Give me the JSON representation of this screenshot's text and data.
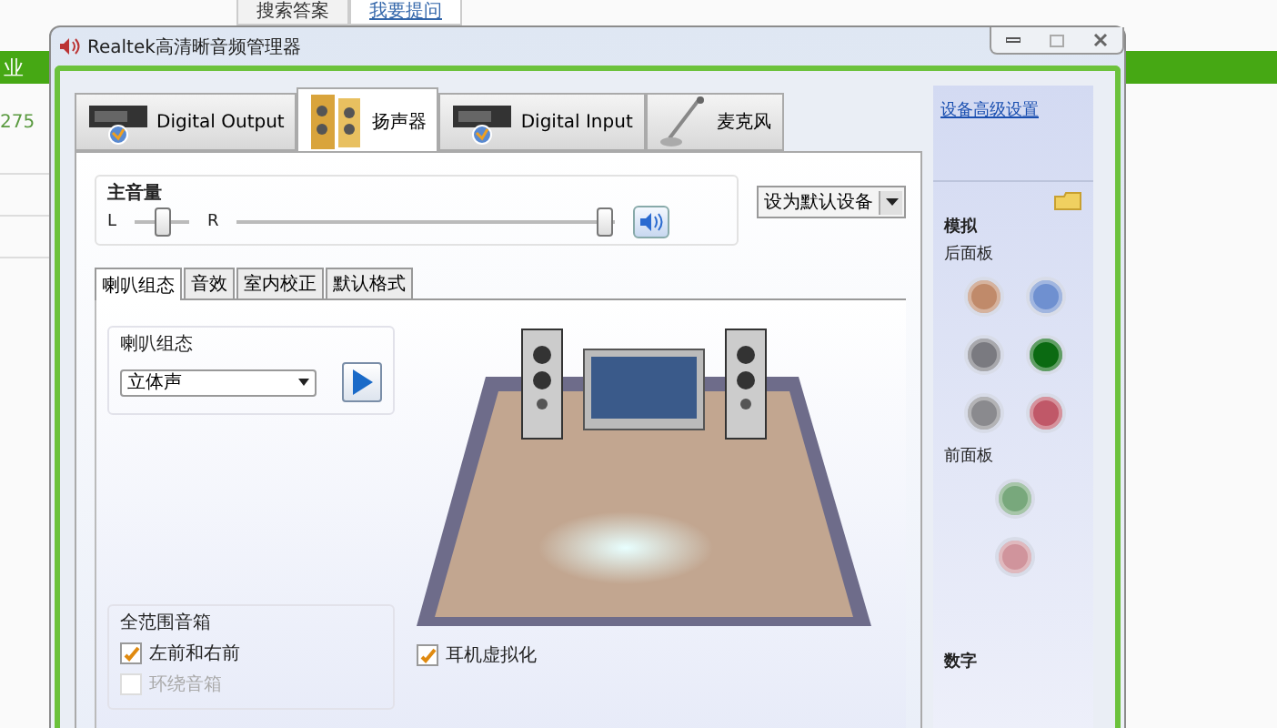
{
  "background_page": {
    "tabs": [
      {
        "label": "搜索答案",
        "selected": true
      },
      {
        "label": "我要提问",
        "selected": false
      }
    ],
    "nav_label": "业",
    "count": "275"
  },
  "window": {
    "title": "Realtek高清晰音频管理器"
  },
  "device_tabs": [
    {
      "label": "Digital Output",
      "kind": "digital",
      "selected": false
    },
    {
      "label": "扬声器",
      "kind": "speaker",
      "selected": true
    },
    {
      "label": "Digital Input",
      "kind": "digital",
      "selected": false
    },
    {
      "label": "麦克风",
      "kind": "mic",
      "selected": false
    }
  ],
  "main_volume": {
    "label": "主音量",
    "left": "L",
    "right": "R",
    "balance": {
      "level": 0.5
    },
    "volume": {
      "level": 0.97
    }
  },
  "default_device": "设为默认设备",
  "sub_tabs": [
    {
      "label": "喇叭组态",
      "selected": true
    },
    {
      "label": "音效",
      "selected": false
    },
    {
      "label": "室内校正",
      "selected": false
    },
    {
      "label": "默认格式",
      "selected": false
    }
  ],
  "speaker_config": {
    "label": "喇叭组态",
    "value": "立体声"
  },
  "full_range": {
    "label": "全范围音箱",
    "options": [
      {
        "label": "左前和右前",
        "checked": true,
        "disabled": false
      },
      {
        "label": "环绕音箱",
        "checked": false,
        "disabled": true
      }
    ]
  },
  "headphone_virtualization": {
    "label": "耳机虚拟化",
    "checked": true
  },
  "sidebar": {
    "link": "设备高级设置",
    "analog": "模拟",
    "back_panel": "后面板",
    "back_jacks": [
      {
        "color": "#c08a6a"
      },
      {
        "color": "#6f90d0"
      },
      {
        "color": "#7a7a80"
      },
      {
        "color": "#0b6a12"
      },
      {
        "color": "#8a8a8e"
      },
      {
        "color": "#c05868"
      }
    ],
    "front_panel": "前面板",
    "front_jacks": [
      {
        "color": "#78a87c"
      },
      {
        "color": "#d0949c"
      }
    ],
    "digital": "数字"
  }
}
